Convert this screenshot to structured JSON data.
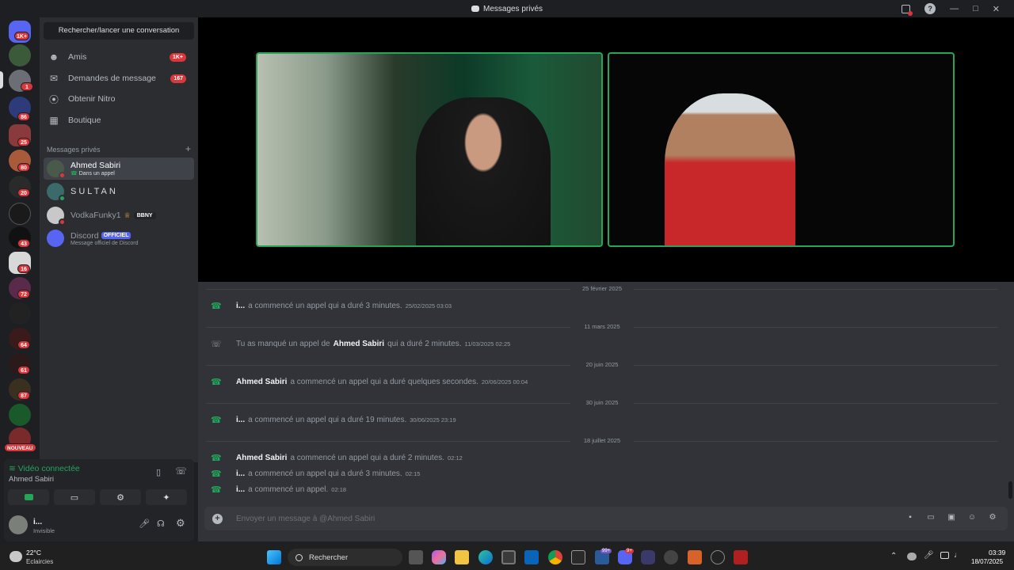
{
  "titlebar": {
    "title": "Messages privés"
  },
  "guilds": {
    "badges": [
      "1K+",
      "1",
      "86",
      "25",
      "80",
      "20",
      "43",
      "16",
      "72",
      "64",
      "61",
      "87"
    ],
    "new_label": "NOUVEAU"
  },
  "sidebar": {
    "search_label": "Rechercher/lancer une conversation",
    "nav": [
      {
        "label": "Amis",
        "badge": "1K+",
        "icon": "friends-icon"
      },
      {
        "label": "Demandes de message",
        "badge": "167",
        "icon": "mail-icon"
      },
      {
        "label": "Obtenir Nitro",
        "badge": "",
        "icon": "nitro-icon"
      },
      {
        "label": "Boutique",
        "badge": "",
        "icon": "shop-icon"
      }
    ],
    "dm_header": "Messages privés",
    "dm_add": "+",
    "dms": [
      {
        "name": "Ahmed Sabiri",
        "sub": "Dans un appel",
        "tag": ""
      },
      {
        "name": "SULTAN",
        "sub": "",
        "tag": ""
      },
      {
        "name": "VodkaFunky1",
        "sub": "",
        "tag": "BBNY"
      },
      {
        "name": "Discord",
        "sub": "Message officiel de Discord",
        "tag": "OFFICIEL"
      }
    ]
  },
  "voice": {
    "status": "Vidéo connectée",
    "channel": "Ahmed Sabiri"
  },
  "user": {
    "name": "i...",
    "status": "Invisible"
  },
  "messages": [
    {
      "date": "25 février 2025"
    },
    {
      "author": "i...",
      "text": "a commencé un appel qui a duré 3 minutes.",
      "ts": "25/02/2025 03:03"
    },
    {
      "date": "11 mars 2025"
    },
    {
      "pre": "Tu as manqué un appel de",
      "author": "Ahmed Sabiri",
      "text": "qui a duré 2 minutes.",
      "ts": "11/03/2025 02:25"
    },
    {
      "date": "20 juin 2025"
    },
    {
      "author": "Ahmed Sabiri",
      "text": "a commencé un appel qui a duré quelques secondes.",
      "ts": "20/06/2025 00:04"
    },
    {
      "date": "30 juin 2025"
    },
    {
      "author": "i...",
      "text": "a commencé un appel qui a duré 19 minutes.",
      "ts": "30/06/2025 23:19"
    },
    {
      "date": "18 juillet 2025"
    },
    {
      "author": "Ahmed Sabiri",
      "text": "a commencé un appel qui a duré 2 minutes.",
      "ts": "02:12"
    },
    {
      "author": "i...",
      "text": "a commencé un appel qui a duré 3 minutes.",
      "ts": "02:15"
    },
    {
      "author": "i...",
      "text": "a commencé un appel.",
      "ts": "02:18"
    }
  ],
  "composer": {
    "placeholder": "Envoyer un message à @Ahmed Sabiri"
  },
  "taskbar": {
    "weather_temp": "22°C",
    "weather_desc": "Eclaircies",
    "search_label": "Rechercher",
    "time": "03:39",
    "date": "18/07/2025",
    "badge_app1": "99+",
    "badge_app2": "9+"
  },
  "colors": {
    "accent": "#23a55a",
    "danger": "#da373c",
    "blurple": "#5865f2"
  }
}
